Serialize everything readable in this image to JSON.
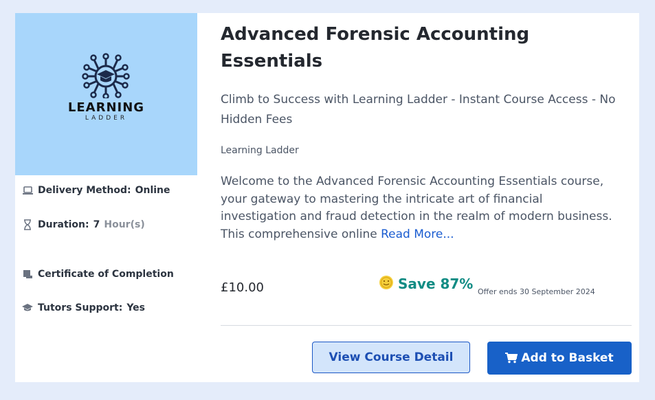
{
  "course": {
    "title": "Advanced Forensic Accounting Essentials",
    "subtitle": "Climb to Success with Learning Ladder - Instant Course Access - No Hidden Fees",
    "provider": "Learning Ladder",
    "description": "Welcome to the Advanced Forensic Accounting Essentials course, your gateway to mastering the intricate art of financial investigation and fraud detection in the realm of modern business. This comprehensive online",
    "read_more": "Read More...",
    "price": "£10.00",
    "save": "Save 87%",
    "offer": "Offer ends 30 September 2024"
  },
  "logo": {
    "title": "LEARNING",
    "subtitle": "LADDER",
    "icon": "graduation-cap-circuit-icon"
  },
  "meta": {
    "delivery_label": "Delivery Method:",
    "delivery_value": "Online",
    "duration_label": "Duration:",
    "duration_value": "7",
    "duration_unit": "Hour(s)",
    "certificate_label": "Certificate of Completion",
    "tutors_label": "Tutors Support:",
    "tutors_value": "Yes"
  },
  "buttons": {
    "view_detail": "View Course Detail",
    "add_basket": "Add to Basket"
  },
  "colors": {
    "page_bg": "#e4ecfa",
    "thumb_bg": "#a8d6fb",
    "accent": "#1861c8",
    "save": "#128c84"
  }
}
